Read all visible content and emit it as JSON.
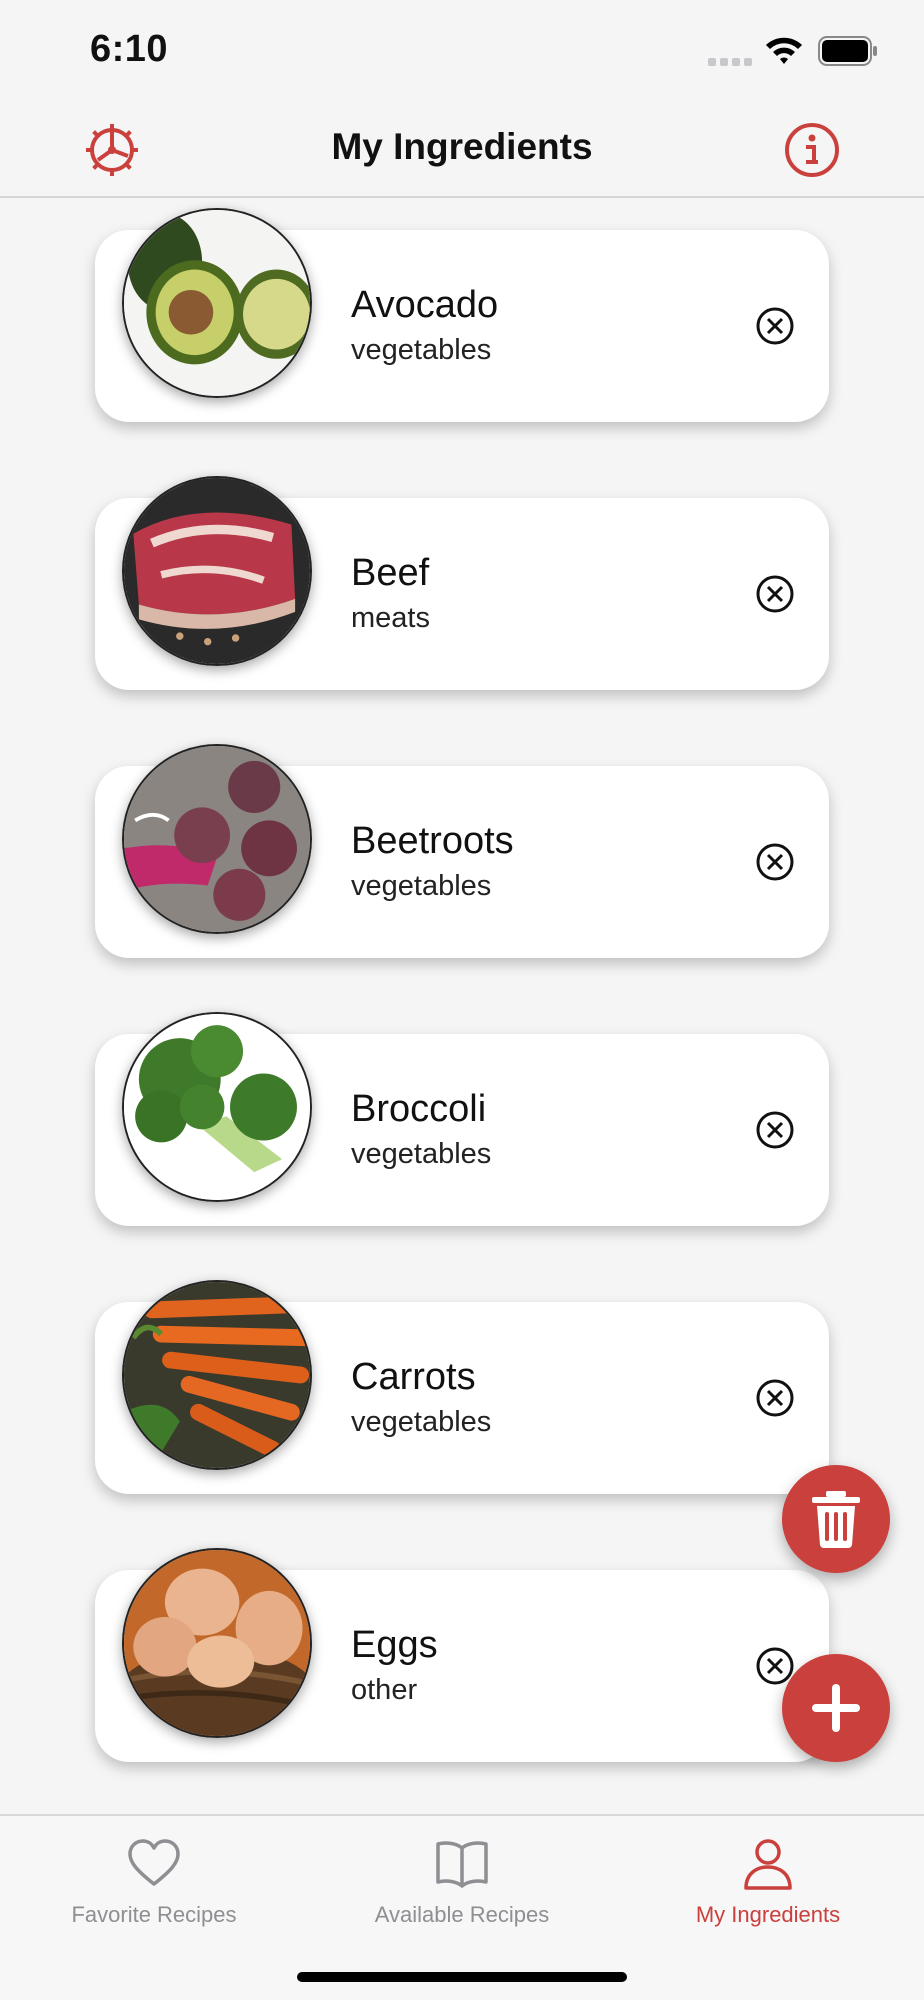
{
  "status_bar": {
    "time": "6:10"
  },
  "nav": {
    "title": "My Ingredients"
  },
  "ingredients": [
    {
      "name": "Avocado",
      "category": "vegetables",
      "icon": "avocado-image"
    },
    {
      "name": "Beef",
      "category": "meats",
      "icon": "beef-image"
    },
    {
      "name": "Beetroots",
      "category": "vegetables",
      "icon": "beetroots-image"
    },
    {
      "name": "Broccoli",
      "category": "vegetables",
      "icon": "broccoli-image"
    },
    {
      "name": "Carrots",
      "category": "vegetables",
      "icon": "carrots-image"
    },
    {
      "name": "Eggs",
      "category": "other",
      "icon": "eggs-image"
    }
  ],
  "tabs": [
    {
      "label": "Favorite Recipes",
      "icon": "heart-icon"
    },
    {
      "label": "Available Recipes",
      "icon": "book-icon"
    },
    {
      "label": "My Ingredients",
      "icon": "person-icon",
      "active": true
    }
  ],
  "colors": {
    "accent": "#c9403d",
    "background": "#f5f5f5",
    "inactive": "#8e8e93"
  }
}
